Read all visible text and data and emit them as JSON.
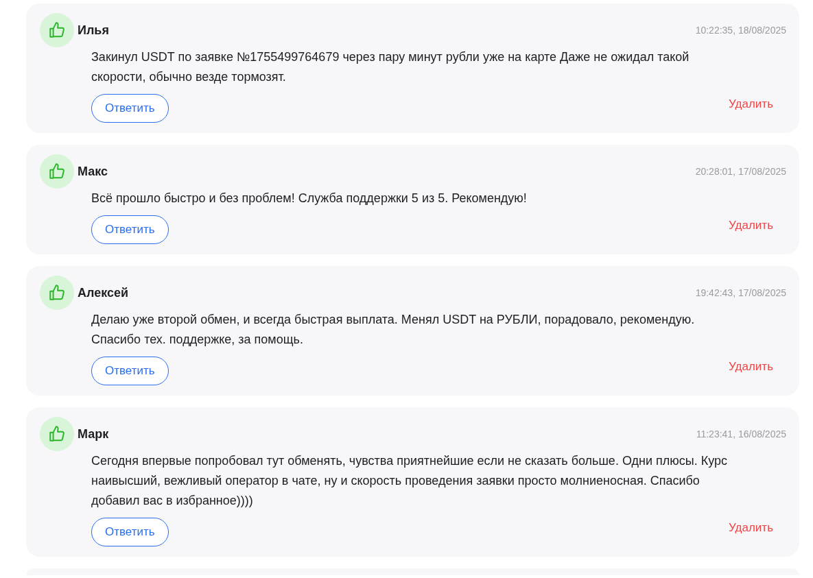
{
  "reviews": [
    {
      "name": "Илья",
      "time": "10:22:35, 18/08/2025",
      "text": "Закинул USDT по заявке №1755499764679 через пару минут рубли уже на карте Даже не ожидал такой скорости, обычно везде тормозят.",
      "reply": "Ответить",
      "delete": "Удалить"
    },
    {
      "name": "Макс",
      "time": "20:28:01, 17/08/2025",
      "text": "Всё прошло быстро и без проблем! Служба поддержки 5 из 5. Рекомендую!",
      "reply": "Ответить",
      "delete": "Удалить"
    },
    {
      "name": "Алексей",
      "time": "19:42:43, 17/08/2025",
      "text": "Делаю уже второй обмен, и всегда быстрая выплата. Менял USDT на РУБЛИ, порадовало, рекомендую. Спасибо тех. поддержке, за помощь.",
      "reply": "Ответить",
      "delete": "Удалить"
    },
    {
      "name": "Марк",
      "time": "11:23:41, 16/08/2025",
      "text": "Сегодня впервые попробовал тут обменять, чувства приятнейшие если не сказать больше. Одни плюсы. Курс наивысший, вежливый оператор в чате, ну и скорость проведения заявки просто молниеносная. Спасибо добавил вас в избранное))))",
      "reply": "Ответить",
      "delete": "Удалить"
    }
  ]
}
